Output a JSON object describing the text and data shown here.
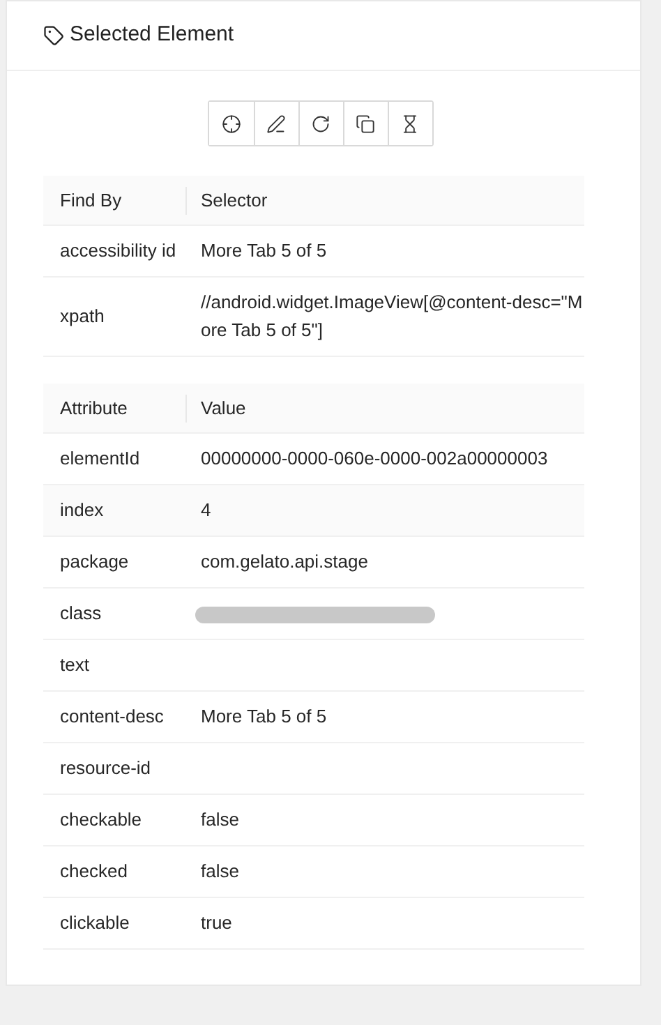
{
  "panel": {
    "title": "Selected Element"
  },
  "toolbar": [
    {
      "kind": "locate"
    },
    {
      "kind": "edit"
    },
    {
      "kind": "refresh"
    },
    {
      "kind": "copy"
    },
    {
      "kind": "timer"
    }
  ],
  "selectors": {
    "columns": [
      "Find By",
      "Selector"
    ],
    "rows": [
      {
        "cells": [
          "accessibility id",
          "More Tab 5 of 5"
        ],
        "highlighted": false
      },
      {
        "cells": [
          "xpath",
          "//android.widget.ImageView[@content-desc=\"More Tab 5 of 5\"]"
        ],
        "highlighted": false
      }
    ]
  },
  "attributes": {
    "columns": [
      "Attribute",
      "Value"
    ],
    "rows": [
      {
        "cells": [
          "elementId",
          "00000000-0000-060e-0000-002a00000003"
        ],
        "highlighted": false,
        "redacted": false
      },
      {
        "cells": [
          "index",
          "4"
        ],
        "highlighted": true,
        "redacted": false
      },
      {
        "cells": [
          "package",
          "com.gelato.api.stage"
        ],
        "highlighted": false,
        "redacted": false
      },
      {
        "cells": [
          "class"
        ],
        "highlighted": false,
        "redacted": true
      },
      {
        "cells": [
          "text"
        ],
        "highlighted": false,
        "redacted": false
      },
      {
        "cells": [
          "content-desc",
          "More Tab 5 of 5"
        ],
        "highlighted": false,
        "redacted": false
      },
      {
        "cells": [
          "resource-id"
        ],
        "highlighted": false,
        "redacted": false
      },
      {
        "cells": [
          "checkable",
          "false"
        ],
        "highlighted": false,
        "redacted": false
      },
      {
        "cells": [
          "checked",
          "false"
        ],
        "highlighted": false,
        "redacted": false
      },
      {
        "cells": [
          "clickable",
          "true"
        ],
        "highlighted": false,
        "redacted": false
      }
    ]
  }
}
